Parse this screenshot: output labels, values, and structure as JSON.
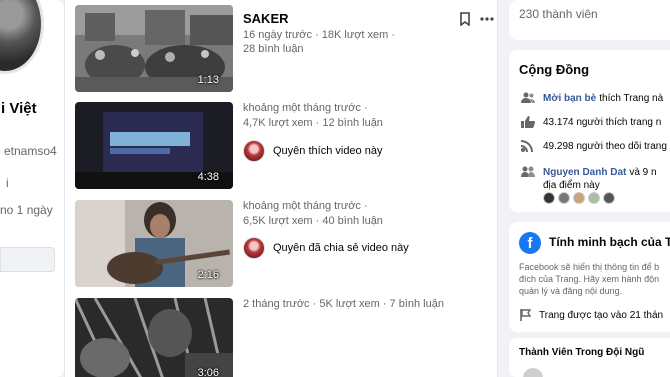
{
  "profile": {
    "name_fragment": "i Việt",
    "id_fragment": "etnamso4",
    "line_fragment": "i",
    "time_fragment": "no 1 ngày"
  },
  "videos": [
    {
      "title": "SAKER",
      "meta": "16 ngày trước · 18K lượt xem ·",
      "meta2": "28 bình luận",
      "duration": "1:13",
      "thumb_icon": "street-scene-thumbnail"
    },
    {
      "meta": "khoảng một tháng trước ·",
      "meta2": "4,7K lượt xem · 12 bình luận",
      "friend_text": "Quyên thích video này",
      "duration": "4:38",
      "thumb_icon": "stage-screen-thumbnail"
    },
    {
      "meta": "khoảng một tháng trước ·",
      "meta2": "6,5K lượt xem · 40 bình luận",
      "friend_text": "Quyên đã chia sẻ video này",
      "duration": "2:16",
      "thumb_icon": "guitar-player-thumbnail"
    },
    {
      "meta": "2 tháng trước · 5K lượt xem · 7 bình luận",
      "duration": "3:06",
      "thumb_icon": "monochrome-thumbnail"
    }
  ],
  "right": {
    "members": "230 thành viên",
    "community_title": "Cộng Đồng",
    "community": [
      {
        "bold": "Mời bạn bè",
        "text": "thích Trang nà",
        "icon": "invite-friends-icon"
      },
      {
        "bold": "",
        "text": "43.174 người thích trang n",
        "icon": "thumbs-up-icon"
      },
      {
        "bold": "",
        "text": "49.298 người theo dõi trang",
        "icon": "follow-rss-icon"
      },
      {
        "bold": "Nguyen Danh Dat",
        "text": "và 9 n",
        "icon": "people-checkin-icon"
      }
    ],
    "place_text": "địa điểm này",
    "transparency_title": "Tính minh bạch của T",
    "transparency_desc": [
      "Facebook sẽ hiển thị thông tin để b",
      "đích của Trang. Hãy xem hành độn",
      "quản lý và đăng nội dung."
    ],
    "created_text": "Trang được tạo vào 21 thán",
    "team_title": "Thành Viên Trong Đội Ngũ"
  },
  "colors": {
    "page_bg": "#f0f2f5",
    "link_blue": "#385898",
    "fb_blue": "#1877f2",
    "muted": "#65676b"
  }
}
